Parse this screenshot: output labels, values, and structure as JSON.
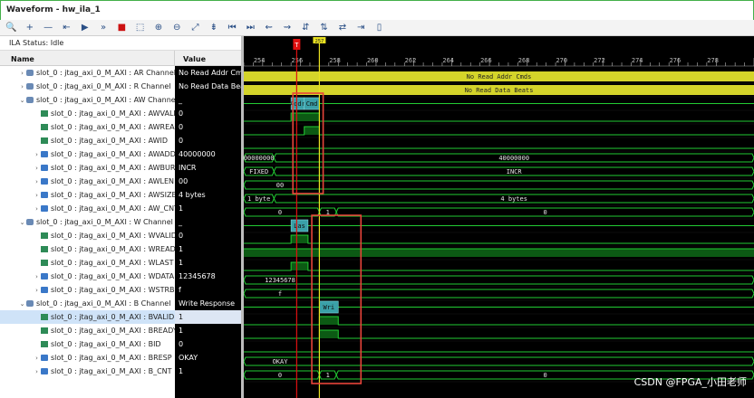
{
  "window": {
    "title": "Waveform - hw_ila_1"
  },
  "toolbar": {
    "icons": [
      "search-icon",
      "zoom-plus-icon",
      "zoom-minus-icon",
      "previous-icon",
      "run-icon",
      "run-fast-icon",
      "stop-icon",
      "zoom-fit-icon",
      "zoom-in-icon",
      "zoom-out-icon",
      "fit-window-icon",
      "marker-icon",
      "go-first-icon",
      "go-last-icon",
      "prev-transition-icon",
      "next-transition-icon",
      "add-marker-icon",
      "swap-icon",
      "swap-alt-icon",
      "snap-icon",
      "disabled-icon"
    ],
    "glyphs": [
      "🔍",
      "+",
      "—",
      "⇤",
      "▶",
      "»",
      "■",
      "⬚",
      "⊕",
      "⊖",
      "⤢",
      "⇟",
      "⏮",
      "⏭",
      "⇜",
      "⇝",
      "⇵",
      "⇅",
      "⇄",
      "⇥",
      "▯"
    ]
  },
  "status": {
    "text": "ILA Status:  Idle"
  },
  "headers": {
    "name": "Name",
    "value": "Value"
  },
  "rows": [
    {
      "name": "slot_0 : jtag_axi_0_M_AXI : AR Channel",
      "value": "No Read Addr Cmds",
      "kind": "grp",
      "chev": "›",
      "indent": 1
    },
    {
      "name": "slot_0 : jtag_axi_0_M_AXI : R Channel",
      "value": "No Read Data Beats",
      "kind": "grp",
      "chev": "›",
      "indent": 1
    },
    {
      "name": "slot_0 : jtag_axi_0_M_AXI : AW Channel",
      "value": "_",
      "kind": "grp",
      "chev": "⌄",
      "indent": 1
    },
    {
      "name": "slot_0 : jtag_axi_0_M_AXI : AWVALID",
      "value": "0",
      "kind": "bit",
      "chev": "",
      "indent": 2
    },
    {
      "name": "slot_0 : jtag_axi_0_M_AXI : AWREADY",
      "value": "0",
      "kind": "bit",
      "chev": "",
      "indent": 2
    },
    {
      "name": "slot_0 : jtag_axi_0_M_AXI : AWID",
      "value": "0",
      "kind": "bit",
      "chev": "",
      "indent": 2
    },
    {
      "name": "slot_0 : jtag_axi_0_M_AXI : AWADDR",
      "value": "40000000",
      "kind": "bus",
      "chev": "›",
      "indent": 2
    },
    {
      "name": "slot_0 : jtag_axi_0_M_AXI : AWBURST",
      "value": "INCR",
      "kind": "bus",
      "chev": "›",
      "indent": 2
    },
    {
      "name": "slot_0 : jtag_axi_0_M_AXI : AWLEN",
      "value": "00",
      "kind": "bus",
      "chev": "›",
      "indent": 2
    },
    {
      "name": "slot_0 : jtag_axi_0_M_AXI : AWSIZE",
      "value": "4 bytes",
      "kind": "bus",
      "chev": "›",
      "indent": 2
    },
    {
      "name": "slot_0 : jtag_axi_0_M_AXI : AW_CNT",
      "value": "1",
      "kind": "bus",
      "chev": "›",
      "indent": 2
    },
    {
      "name": "slot_0 : jtag_axi_0_M_AXI : W Channel",
      "value": "_",
      "kind": "grp",
      "chev": "⌄",
      "indent": 1
    },
    {
      "name": "slot_0 : jtag_axi_0_M_AXI : WVALID",
      "value": "0",
      "kind": "bit",
      "chev": "",
      "indent": 2
    },
    {
      "name": "slot_0 : jtag_axi_0_M_AXI : WREADY",
      "value": "1",
      "kind": "bit",
      "chev": "",
      "indent": 2
    },
    {
      "name": "slot_0 : jtag_axi_0_M_AXI : WLAST",
      "value": "1",
      "kind": "bit",
      "chev": "",
      "indent": 2
    },
    {
      "name": "slot_0 : jtag_axi_0_M_AXI : WDATA",
      "value": "12345678",
      "kind": "bus",
      "chev": "›",
      "indent": 2
    },
    {
      "name": "slot_0 : jtag_axi_0_M_AXI : WSTRB",
      "value": "f",
      "kind": "bus",
      "chev": "›",
      "indent": 2
    },
    {
      "name": "slot_0 : jtag_axi_0_M_AXI : B Channel",
      "value": "Write Response",
      "kind": "grp",
      "chev": "⌄",
      "indent": 1
    },
    {
      "name": "slot_0 : jtag_axi_0_M_AXI : BVALID",
      "value": "1",
      "kind": "bit",
      "chev": "",
      "indent": 2,
      "selected": true
    },
    {
      "name": "slot_0 : jtag_axi_0_M_AXI : BREADY",
      "value": "1",
      "kind": "bit",
      "chev": "",
      "indent": 2
    },
    {
      "name": "slot_0 : jtag_axi_0_M_AXI : BID",
      "value": "0",
      "kind": "bit",
      "chev": "",
      "indent": 2
    },
    {
      "name": "slot_0 : jtag_axi_0_M_AXI : BRESP",
      "value": "OKAY",
      "kind": "bus",
      "chev": "›",
      "indent": 2
    },
    {
      "name": "slot_0 : jtag_axi_0_M_AXI : B_CNT",
      "value": "1",
      "kind": "bus",
      "chev": "›",
      "indent": 2
    }
  ],
  "timeline": {
    "start": 253,
    "end": 280,
    "ticks": [
      254,
      256,
      258,
      260,
      262,
      264,
      266,
      268,
      270,
      272,
      274,
      276,
      278
    ],
    "cursor_red": 255.8,
    "cursor_yellow": 257.0,
    "cursor_red_label": "T",
    "cursor_yellow_label": "257"
  },
  "waves": [
    {
      "type": "bar",
      "text": "No Read Addr Cmds"
    },
    {
      "type": "bar",
      "text": "No Read Data Beats"
    },
    {
      "type": "group",
      "segs": [
        {
          "from": 255.5,
          "to": 256.2,
          "text": "Addr"
        },
        {
          "from": 256.2,
          "to": 257.0,
          "text": "Cmd"
        }
      ]
    },
    {
      "type": "bit",
      "trans": [
        [
          253,
          0
        ],
        [
          255.5,
          1
        ],
        [
          257.0,
          0
        ]
      ]
    },
    {
      "type": "bit",
      "trans": [
        [
          253,
          0
        ],
        [
          256.2,
          1
        ],
        [
          257.0,
          0
        ]
      ]
    },
    {
      "type": "bit",
      "trans": [
        [
          253,
          0
        ]
      ]
    },
    {
      "type": "bus",
      "segs": [
        {
          "from": 253,
          "to": 254.6,
          "text": "00000000"
        },
        {
          "from": 254.6,
          "to": 280,
          "text": "40000000"
        }
      ]
    },
    {
      "type": "bus",
      "segs": [
        {
          "from": 253,
          "to": 254.6,
          "text": "FIXED"
        },
        {
          "from": 254.6,
          "to": 280,
          "text": "INCR"
        }
      ]
    },
    {
      "type": "bus",
      "segs": [
        {
          "from": 253,
          "to": 280,
          "text": "00"
        }
      ]
    },
    {
      "type": "bus",
      "segs": [
        {
          "from": 253,
          "to": 254.6,
          "text": "1 byte"
        },
        {
          "from": 254.6,
          "to": 280,
          "text": "4 bytes"
        }
      ]
    },
    {
      "type": "bus",
      "segs": [
        {
          "from": 253,
          "to": 257.0,
          "text": "0"
        },
        {
          "from": 257.0,
          "to": 257.9,
          "text": "1"
        },
        {
          "from": 257.9,
          "to": 280,
          "text": "0"
        }
      ]
    },
    {
      "type": "group",
      "segs": [
        {
          "from": 255.5,
          "to": 256.4,
          "text": "Las"
        }
      ]
    },
    {
      "type": "bit",
      "trans": [
        [
          253,
          0
        ],
        [
          255.5,
          1
        ],
        [
          256.4,
          0
        ]
      ]
    },
    {
      "type": "bit",
      "trans": [
        [
          253,
          1
        ]
      ]
    },
    {
      "type": "bit",
      "trans": [
        [
          253,
          0
        ],
        [
          255.5,
          1
        ],
        [
          256.4,
          0
        ]
      ]
    },
    {
      "type": "bus",
      "segs": [
        {
          "from": 253,
          "to": 280,
          "text": "12345678"
        }
      ]
    },
    {
      "type": "bus",
      "segs": [
        {
          "from": 253,
          "to": 280,
          "text": "f"
        }
      ]
    },
    {
      "type": "group",
      "segs": [
        {
          "from": 257.0,
          "to": 258.0,
          "text": "Wri"
        }
      ]
    },
    {
      "type": "bit",
      "trans": [
        [
          253,
          0
        ],
        [
          257.0,
          1
        ],
        [
          258.0,
          0
        ]
      ]
    },
    {
      "type": "bit",
      "trans": [
        [
          253,
          0
        ],
        [
          257.0,
          1
        ],
        [
          258.0,
          0
        ]
      ]
    },
    {
      "type": "bit",
      "trans": [
        [
          253,
          0
        ]
      ]
    },
    {
      "type": "bus",
      "segs": [
        {
          "from": 253,
          "to": 280,
          "text": "OKAY"
        }
      ]
    },
    {
      "type": "bus",
      "segs": [
        {
          "from": 253,
          "to": 257.0,
          "text": "0"
        },
        {
          "from": 257.0,
          "to": 257.9,
          "text": "1"
        },
        {
          "from": 257.9,
          "to": 280,
          "text": "0"
        }
      ]
    }
  ],
  "annotations": [
    {
      "from_time": 255.6,
      "to_time": 257.2,
      "from_row": 2,
      "to_row": 8
    },
    {
      "from_time": 256.6,
      "to_time": 259.2,
      "from_row": 11,
      "to_row": 22
    }
  ],
  "watermark": "CSDN @FPGA_小田老师",
  "colors": {
    "wave_bg": "#000000",
    "signal": "#22cc33",
    "high_fill": "#0c5a14",
    "bar_fill": "#d4d42a",
    "group_box": "#3aa0a8",
    "cursor_red": "#e01010",
    "cursor_yellow": "#e8e020",
    "annotation": "#e8443a",
    "bus_text": "#e6e6e6"
  }
}
